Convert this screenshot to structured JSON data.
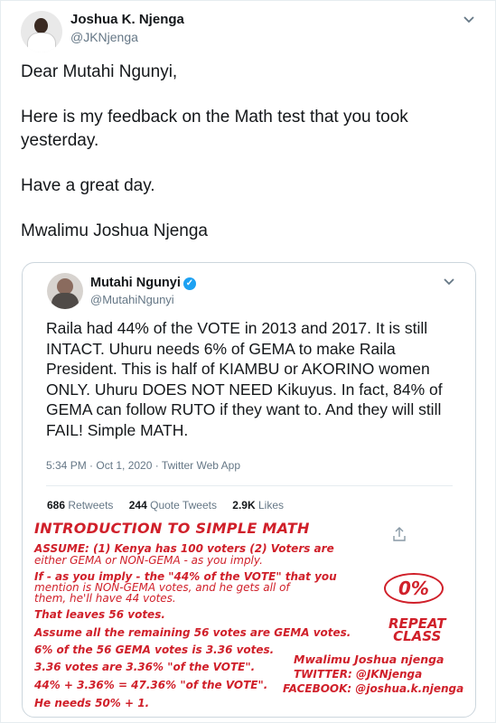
{
  "tweet": {
    "author_name": "Joshua K. Njenga",
    "author_handle": "@JKNjenga",
    "paragraphs": [
      "Dear Mutahi Ngunyi,",
      "Here is my feedback on the Math test that you took yesterday.",
      "Have a great day.",
      "Mwalimu Joshua Njenga"
    ]
  },
  "quoted": {
    "author_name": "Mutahi Ngunyi",
    "author_handle": "@MutahiNgunyi",
    "text": "Raila had 44% of the VOTE in 2013 and 2017. It is still INTACT. Uhuru needs 6% of GEMA to make Raila President. This is half of KIAMBU or AKORINO women ONLY. Uhuru DOES NOT NEED Kikuyus. In fact, 84% of GEMA can follow RUTO if they want to. And they will still FAIL! Simple MATH.",
    "meta": "5:34 PM · Oct 1, 2020 · Twitter Web App",
    "stats": {
      "retweets_count": "686",
      "retweets_label": "Retweets",
      "quotes_count": "244",
      "quotes_label": "Quote Tweets",
      "likes_count": "2.9K",
      "likes_label": "Likes"
    }
  },
  "annotation": {
    "title": "INTRODUCTION TO SIMPLE MATH",
    "lines": [
      "ASSUME: (1) Kenya has 100 voters (2) Voters are",
      "either GEMA or NON-GEMA - as you imply.",
      "If - as you imply - the \"44% of the VOTE\" that you",
      "mention is NON-GEMA votes, and he gets all of",
      "them, he'll have 44 votes.",
      "That leaves 56 votes.",
      "Assume all the remaining 56 votes are GEMA votes.",
      "6% of the 56 GEMA votes is 3.36 votes.",
      "3.36 votes are 3.36% \"of the VOTE\".",
      "44% + 3.36% = 47.36% \"of the VOTE\".",
      "He needs 50% + 1."
    ],
    "grade": "0%",
    "verdict_line1": "REPEAT",
    "verdict_line2": "CLASS",
    "signature": "Mwalimu Joshua njenga",
    "twitter": "TWITTER: @JKNjenga",
    "facebook": "FACEBOOK: @joshua.k.njenga"
  },
  "colors": {
    "accent": "#1da1f2",
    "ink": "#d0202a",
    "muted": "#657786"
  },
  "icons": {
    "menu": "chevron-down-icon",
    "verified": "verified-badge-icon",
    "share": "share-icon"
  }
}
